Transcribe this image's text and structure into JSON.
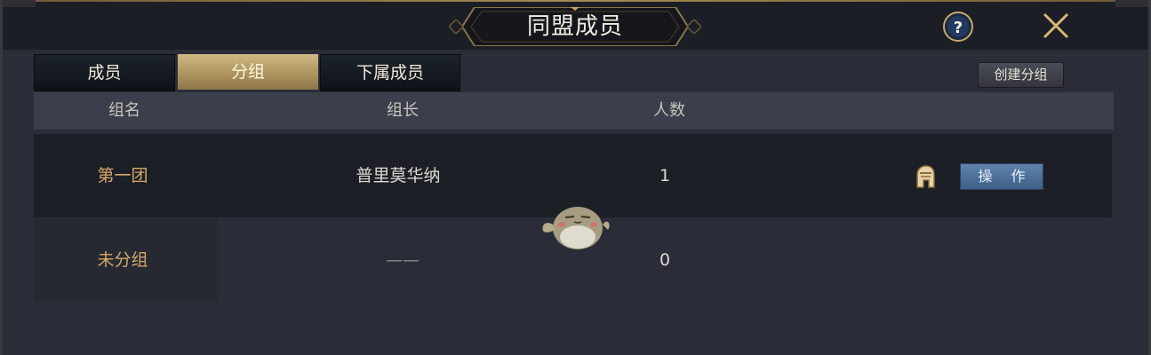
{
  "window": {
    "title": "同盟成员"
  },
  "tabs": [
    {
      "label": "成员",
      "active": false
    },
    {
      "label": "分组",
      "active": true
    },
    {
      "label": "下属成员",
      "active": false
    }
  ],
  "toolbar": {
    "create_group_label": "创建分组"
  },
  "table": {
    "columns": [
      "组名",
      "组长",
      "人数"
    ],
    "rows": [
      {
        "name": "第一团",
        "leader": "普里莫华纳",
        "count": "1",
        "action_label": "操 作"
      },
      {
        "name": "未分组",
        "leader": "——",
        "count": "0"
      }
    ]
  },
  "icons": {
    "help": "help-icon",
    "close": "close-icon",
    "leader": "helmet-icon",
    "watermark": "mascot-watermark"
  },
  "colors": {
    "gold_text": "#d3a768",
    "active_tab": "#c2a873",
    "action_button": "#4c6f98"
  }
}
